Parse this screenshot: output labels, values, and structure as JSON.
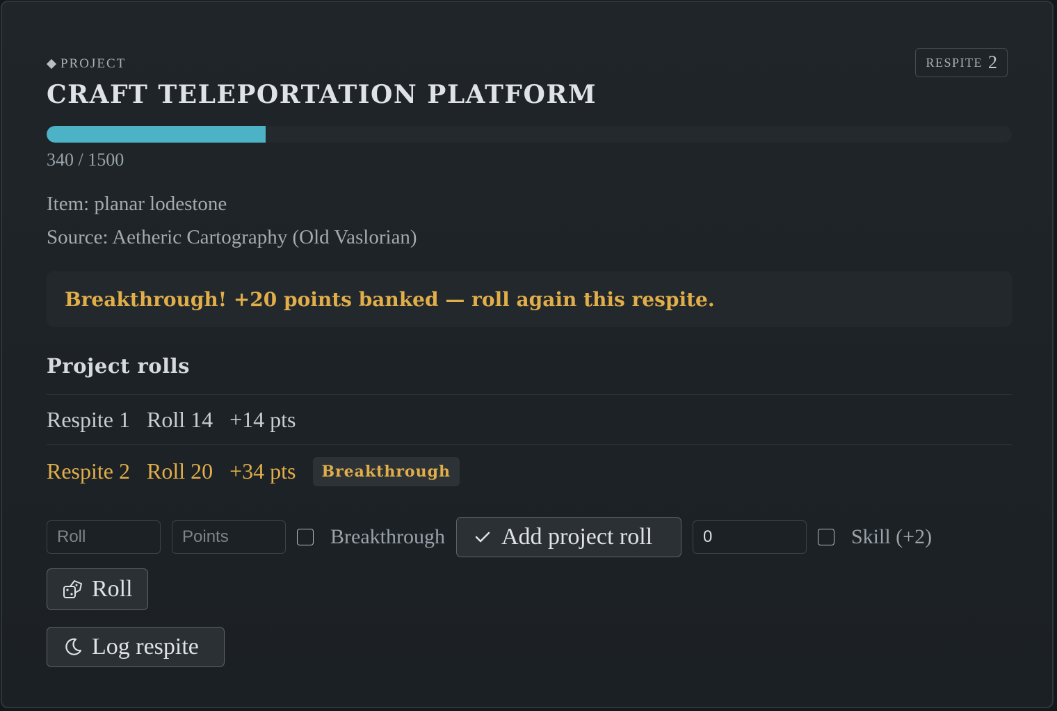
{
  "header": {
    "kicker": "PROJECT",
    "title": "CRAFT TELEPORTATION PLATFORM",
    "respite_label": "RESPITE",
    "respite_number": "2"
  },
  "progress": {
    "current": 340,
    "total": 1500,
    "text": "340 / 1500",
    "color": "#4cb3c6"
  },
  "details": {
    "item": "Item: planar lodestone",
    "source": "Source: Aetheric Cartography (Old Vaslorian)"
  },
  "banner": {
    "text": "Breakthrough! +20 points banked — roll again this respite.",
    "color": "#e2ae4a"
  },
  "rolls_section": {
    "title": "Project rolls",
    "rows": [
      {
        "respite": "Respite 1",
        "roll": "Roll 14",
        "points": "+14 pts",
        "tag": ""
      },
      {
        "respite": "Respite 2",
        "roll": "Roll 20",
        "points": "+34 pts",
        "tag": "Breakthrough"
      }
    ]
  },
  "form": {
    "roll_placeholder": "Roll",
    "points_placeholder": "Points",
    "breakthrough_label": "Breakthrough",
    "breakthrough_checked": false,
    "add_button": "Add project roll",
    "modifier_value": "0",
    "skill_label": "Skill (+2)",
    "skill_checked": false,
    "roll_button": "Roll",
    "log_button": "Log respite"
  },
  "icons": {
    "kicker": "diamond-icon",
    "add": "check-icon",
    "roll": "dice-icon",
    "log": "moon-icon"
  }
}
